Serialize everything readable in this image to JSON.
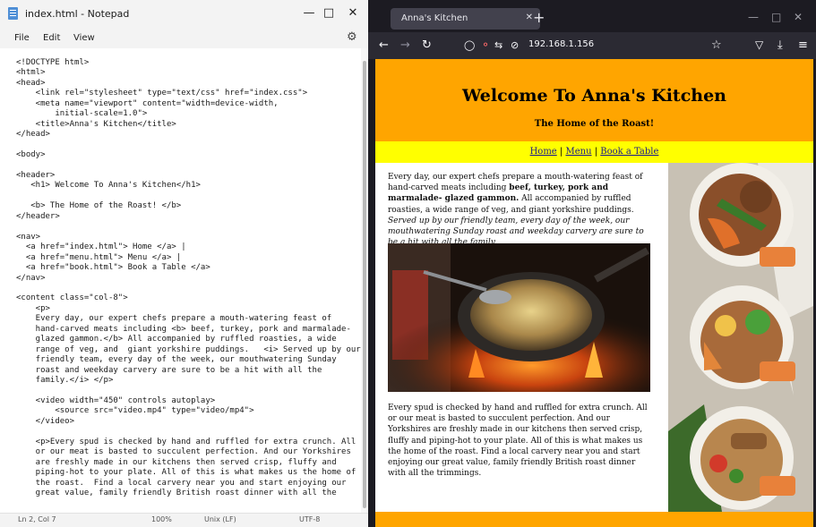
{
  "notepad": {
    "title": "index.html - Notepad",
    "menu": [
      "File",
      "Edit",
      "View"
    ],
    "code_lines": [
      "<!DOCTYPE html>",
      "<html>",
      "<head>",
      "    <link rel=\"stylesheet\" type=\"text/css\" href=\"index.css\">",
      "    <meta name=\"viewport\" content=\"width=device-width,",
      "        initial-scale=1.0\">",
      "    <title>Anna's Kitchen</title>",
      "</head>",
      "",
      "<body>",
      "",
      "<header>",
      "   <h1> Welcome To Anna's Kitchen</h1>",
      "",
      "   <b> The Home of the Roast! </b>",
      "</header>",
      "",
      "<nav>",
      "  <a href=\"index.html\"> Home </a> |",
      "  <a href=\"menu.html\"> Menu </a> |",
      "  <a href=\"book.html\"> Book a Table </a>",
      "</nav>",
      "",
      "<content class=\"col-8\">",
      "    <p>",
      "    Every day, our expert chefs prepare a mouth-watering feast of",
      "    hand-carved meats including <b> beef, turkey, pork and marmalade-",
      "    glazed gammon.</b> All accompanied by ruffled roasties, a wide",
      "    range of veg, and  giant yorkshire puddings.   <i> Served up by our",
      "    friendly team, every day of the week, our mouthwatering Sunday",
      "    roast and weekday carvery are sure to be a hit with all the",
      "    family.</i> </p>",
      "",
      "    <video width=\"450\" controls autoplay>",
      "        <source src=\"video.mp4\" type=\"video/mp4\">",
      "    </video>",
      "",
      "    <p>Every spud is checked by hand and ruffled for extra crunch. All",
      "    or our meat is basted to succulent perfection. And our Yorkshires",
      "    are freshly made in our kitchens then served crisp, fluffy and",
      "    piping-hot to your plate. All of this is what makes us the home of",
      "    the roast.  Find a local carvery near you and start enjoying our",
      "    great value, family friendly British roast dinner with all the"
    ],
    "status": {
      "position": "Ln 2, Col 7",
      "zoom": "100%",
      "line_ending": "Unix (LF)",
      "encoding": "UTF-8"
    }
  },
  "browser": {
    "tab_title": "Anna's Kitchen",
    "url": "192.168.1.156"
  },
  "page": {
    "h1": "Welcome To Anna's Kitchen",
    "subtitle": "The Home of the Roast!",
    "nav": {
      "home": "Home",
      "menu": "Menu",
      "book": "Book a Table",
      "sep": " | "
    },
    "p1": {
      "start": "Every day, our expert chefs prepare a mouth-watering feast of hand-carved meats including ",
      "bold": "beef, turkey, pork and marmalade- glazed gammon.",
      "middle": " All accompanied by ruffled roasties, a wide range of veg, and giant yorkshire puddings. ",
      "italic": "Served up by our friendly team, every day of the week, our mouthwatering Sunday roast and weekday carvery are sure to be a hit with all the family."
    },
    "p2": "Every spud is checked by hand and ruffled for extra crunch. All or our meat is basted to succulent perfection. And our Yorkshires are freshly made in our kitchens then served crisp, fluffy and piping-hot to your plate. All of this is what makes us the home of the roast. Find a local carvery near you and start enjoying our great value, family friendly British roast dinner with all the trimmings."
  },
  "colors": {
    "header_bg": "#ffa500",
    "nav_bg": "#ffff00",
    "browser_chrome": "#1c1b22"
  }
}
